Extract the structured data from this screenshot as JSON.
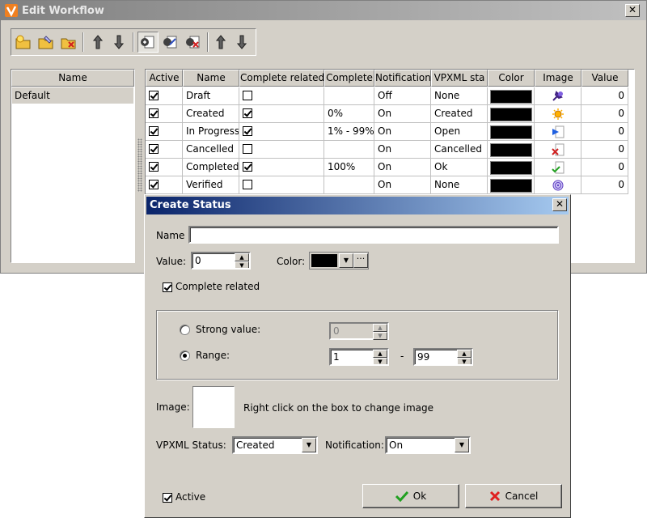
{
  "main_window": {
    "title": "Edit Workflow",
    "close_label": "✕"
  },
  "workflow_list": {
    "header": "Name",
    "items": [
      "Default"
    ]
  },
  "status_table": {
    "columns": [
      "Active",
      "Name",
      "Complete related",
      "Complete",
      "Notification",
      "VPXML sta",
      "Color",
      "Image",
      "Value"
    ],
    "rows": [
      {
        "active": true,
        "name": "Draft",
        "complete_related": false,
        "complete": "",
        "notification": "Off",
        "vpxml": "None",
        "color": "#000000",
        "image": "pin-icon",
        "value": "0"
      },
      {
        "active": true,
        "name": "Created",
        "complete_related": true,
        "complete": "0%",
        "notification": "On",
        "vpxml": "Created",
        "color": "#000000",
        "image": "sun-icon",
        "value": "0"
      },
      {
        "active": true,
        "name": "In Progress",
        "complete_related": true,
        "complete": "1% - 99%",
        "notification": "On",
        "vpxml": "Open",
        "color": "#000000",
        "image": "play-doc-icon",
        "value": "0"
      },
      {
        "active": true,
        "name": "Cancelled",
        "complete_related": false,
        "complete": "",
        "notification": "On",
        "vpxml": "Cancelled",
        "color": "#000000",
        "image": "cancel-doc-icon",
        "value": "0"
      },
      {
        "active": true,
        "name": "Completed",
        "complete_related": true,
        "complete": "100%",
        "notification": "On",
        "vpxml": "Ok",
        "color": "#000000",
        "image": "check-doc-icon",
        "value": "0"
      },
      {
        "active": true,
        "name": "Verified",
        "complete_related": false,
        "complete": "",
        "notification": "On",
        "vpxml": "None",
        "color": "#000000",
        "image": "spiral-icon",
        "value": "0"
      }
    ]
  },
  "dialog": {
    "title": "Create Status",
    "close_label": "✕",
    "name_label": "Name",
    "name_value": "",
    "value_label": "Value:",
    "value_value": "0",
    "color_label": "Color:",
    "color_value": "#000000",
    "complete_related_label": "Complete related",
    "complete_related_checked": true,
    "strong_value_label": "Strong value:",
    "strong_value_value": "0",
    "range_label": "Range:",
    "range_from": "1",
    "range_separator": "-",
    "range_to": "99",
    "range_selected": true,
    "image_label": "Image:",
    "image_hint": "Right click on the box to  change image",
    "vpxml_label": "VPXML Status:",
    "vpxml_value": "Created",
    "notification_label": "Notification:",
    "notification_value": "On",
    "active_label": "Active",
    "active_checked": true,
    "ok_label": "Ok",
    "cancel_label": "Cancel"
  }
}
